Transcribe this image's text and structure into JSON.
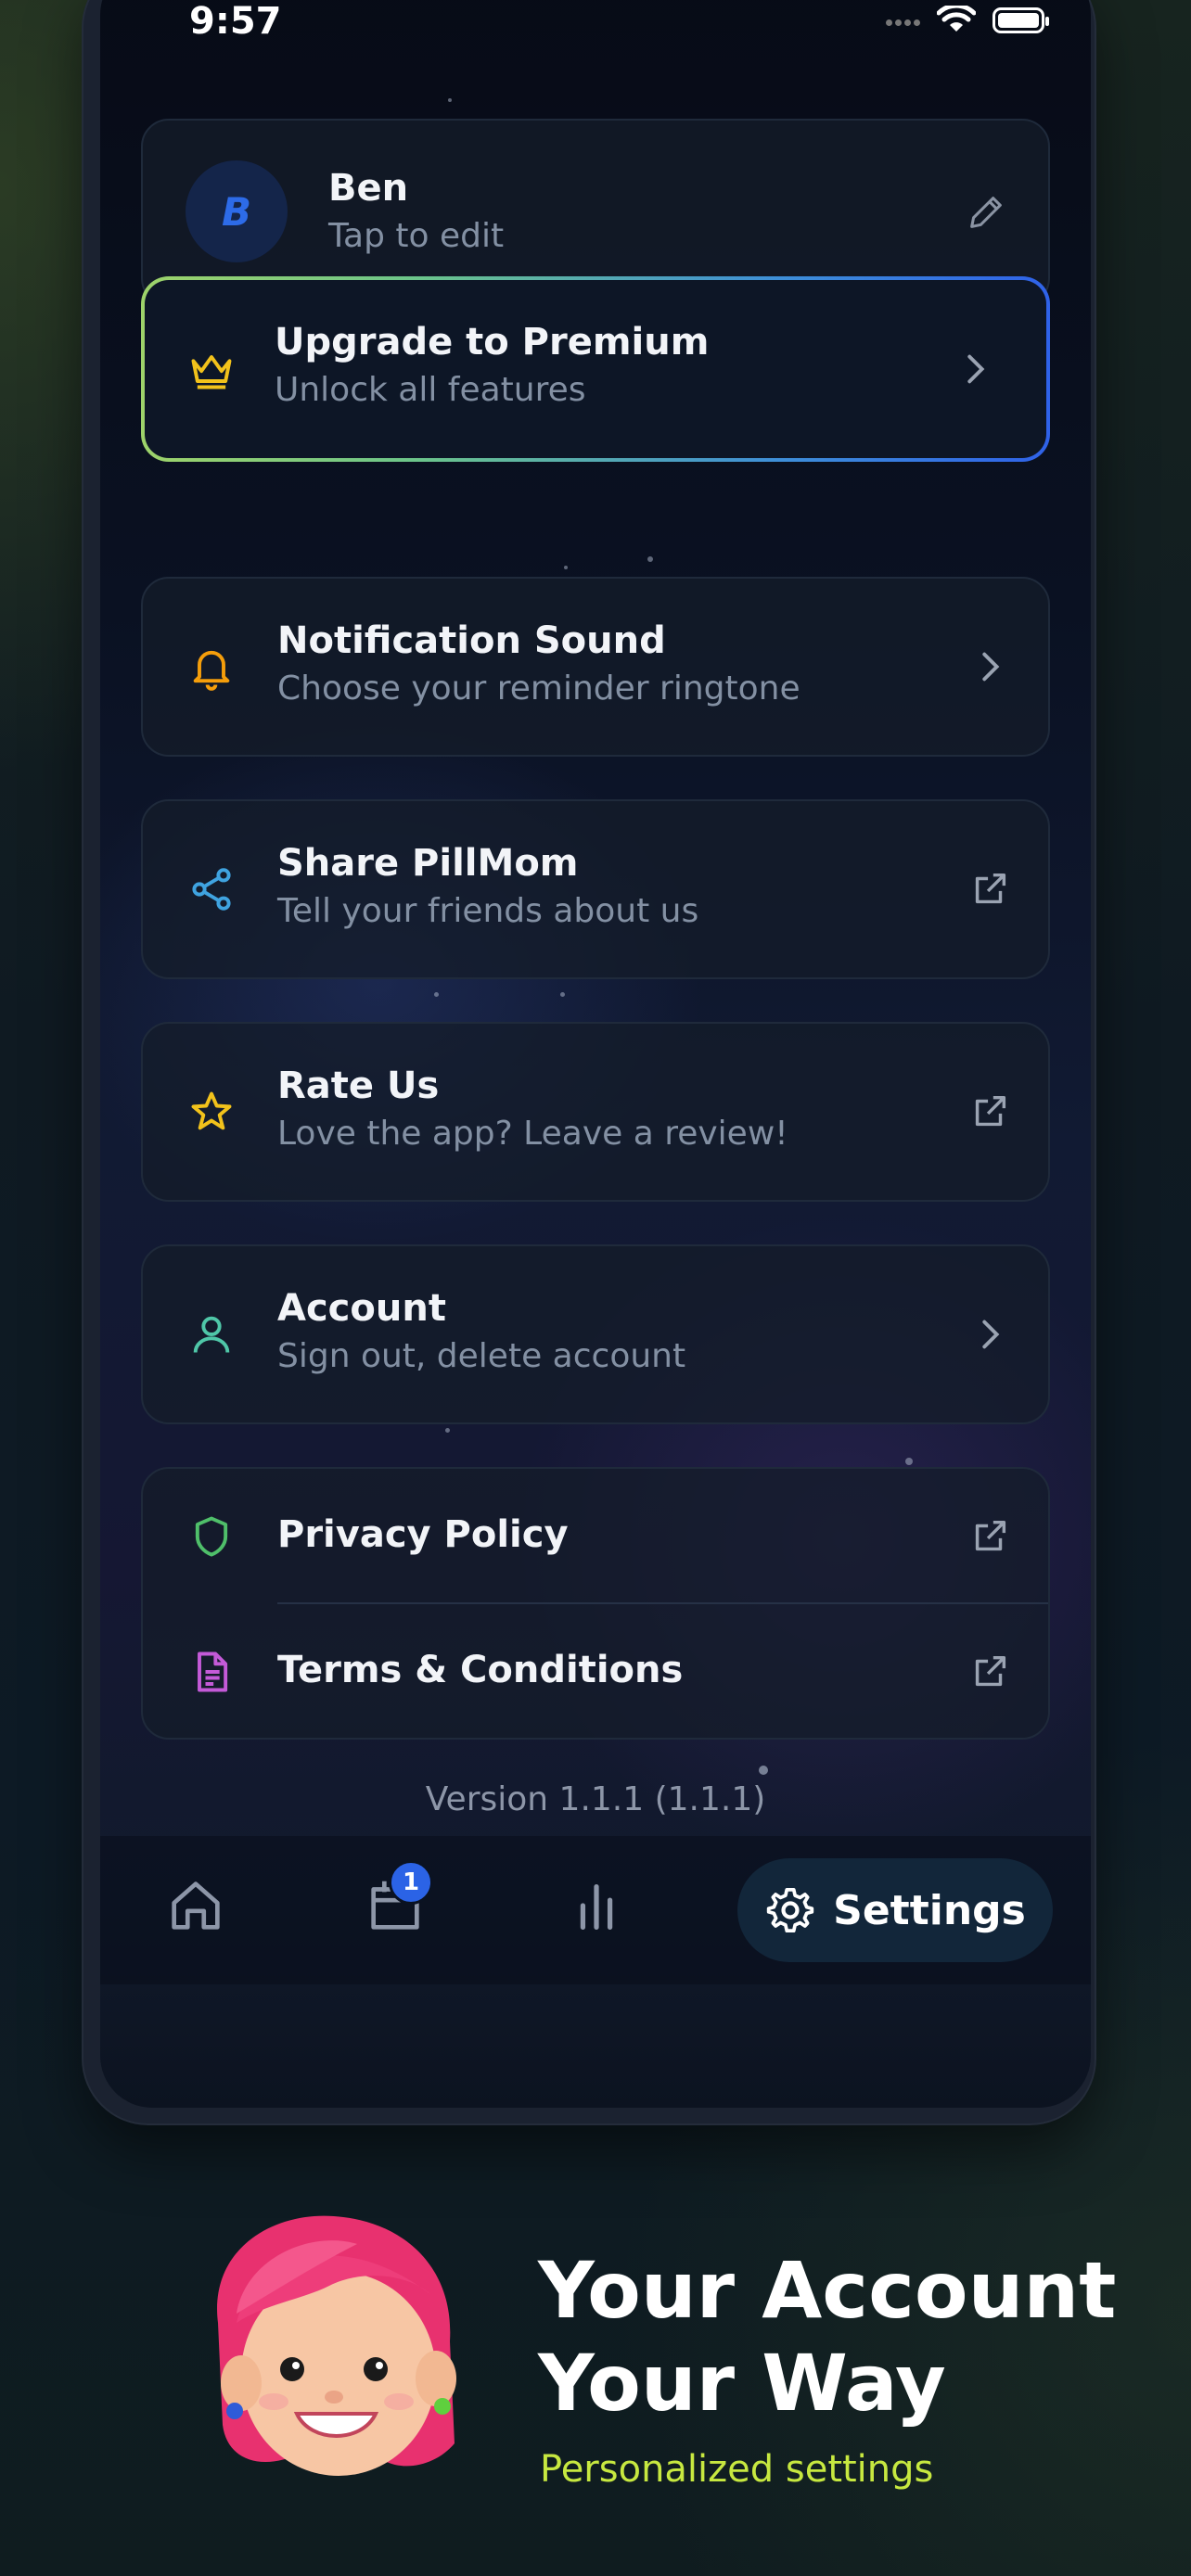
{
  "status_bar": {
    "time": "9:57"
  },
  "profile": {
    "initial": "B",
    "name": "Ben",
    "subtitle": "Tap to edit"
  },
  "premium": {
    "title": "Upgrade to Premium",
    "subtitle": "Unlock all features"
  },
  "menu": [
    {
      "title": "Notification Sound",
      "subtitle": "Choose your reminder ringtone",
      "icon": "bell-icon",
      "action": "chevron-right-icon"
    },
    {
      "title": "Share PillMom",
      "subtitle": "Tell your friends about us",
      "icon": "share-icon",
      "action": "external-link-icon"
    },
    {
      "title": "Rate Us",
      "subtitle": "Love the app? Leave a review!",
      "icon": "star-icon",
      "action": "external-link-icon"
    },
    {
      "title": "Account",
      "subtitle": "Sign out, delete account",
      "icon": "user-icon",
      "action": "chevron-right-icon"
    }
  ],
  "legal": [
    {
      "title": "Privacy Policy",
      "icon": "shield-icon"
    },
    {
      "title": "Terms & Conditions",
      "icon": "document-icon"
    }
  ],
  "version": "Version 1.1.1 (1.1.1)",
  "tabbar": {
    "tabs": [
      {
        "name": "home",
        "icon": "home-icon"
      },
      {
        "name": "calendar",
        "icon": "calendar-icon",
        "badge": "1"
      },
      {
        "name": "stats",
        "icon": "bar-chart-icon"
      },
      {
        "name": "settings",
        "icon": "gear-icon",
        "label": "Settings",
        "active": true
      }
    ]
  },
  "promo": {
    "headline_line1": "Your Account",
    "headline_line2": "Your Way",
    "tagline": "Personalized settings"
  },
  "colors": {
    "accent_blue": "#2b63e6",
    "premium_gold": "#f2c21b",
    "tagline_lime": "#c7e840"
  }
}
